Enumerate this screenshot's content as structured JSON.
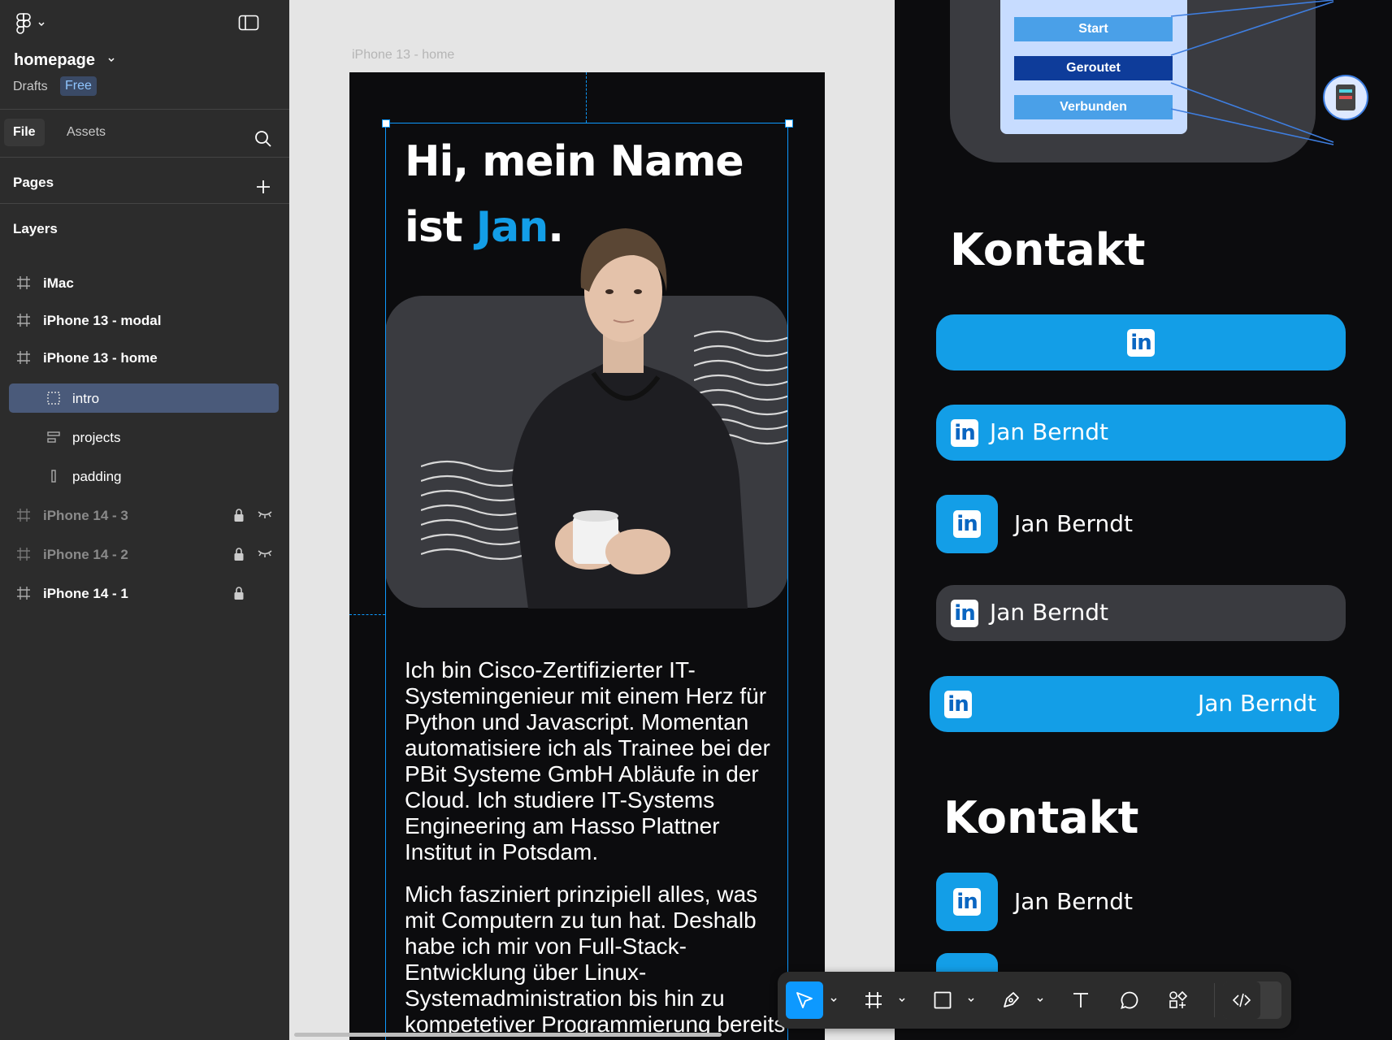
{
  "sidebar": {
    "file_name": "homepage",
    "project": "Drafts",
    "plan_badge": "Free",
    "tabs": {
      "file": "File",
      "assets": "Assets"
    },
    "pages_label": "Pages",
    "layers_label": "Layers",
    "layers": [
      {
        "label": "iMac"
      },
      {
        "label": "iPhone 13 - modal"
      },
      {
        "label": "iPhone 13 - home"
      },
      {
        "label": "intro"
      },
      {
        "label": "projects"
      },
      {
        "label": "padding"
      },
      {
        "label": "iPhone 14 - 3"
      },
      {
        "label": "iPhone 14 - 2"
      },
      {
        "label": "iPhone 14 - 1"
      }
    ]
  },
  "canvas": {
    "frame_label": "iPhone 13 - home",
    "headline_line1": "Hi, mein Name",
    "headline_prefix": "ist ",
    "headline_name": "Jan",
    "headline_dot": ".",
    "paragraph1_lines": [
      "Ich bin Cisco-Zertifizierter IT-",
      "Systemingenieur mit einem Herz für",
      "Python und Javascript. Momentan",
      "automatisiere ich als Trainee bei der",
      "PBit Systeme GmbH Abläufe in der",
      "Cloud. Ich studiere IT-Systems",
      "Engineering am Hasso Plattner",
      "Institut in Potsdam."
    ],
    "paragraph2_lines": [
      "Mich fasziniert prinzipiell alles, was",
      "mit Computern zu tun hat. Deshalb",
      "habe ich mir von Full-Stack-",
      "Entwicklung über Linux-",
      "Systemadministration bis hin zu",
      "kompetetiver Programmierung bereits"
    ],
    "diagram_items": {
      "start": "Start",
      "geroutet": "Geroutet",
      "verbunden": "Verbunden"
    },
    "contact_heading": "Kontakt",
    "contact_name": "Jan Berndt",
    "linkedin_glyph": "in"
  },
  "toolbar": {
    "tools": [
      "move-tool",
      "frame-tool",
      "shape-tool",
      "pen-tool",
      "text-tool",
      "comment-tool",
      "actions-tool",
      "dev-mode-toggle"
    ]
  },
  "colors": {
    "accent_blue": "#139ee7",
    "selection_blue": "#0d99ff",
    "sidebar_bg": "#2c2c2c",
    "frame_bg": "#0c0c0e",
    "card_grey": "#3a3b40"
  }
}
